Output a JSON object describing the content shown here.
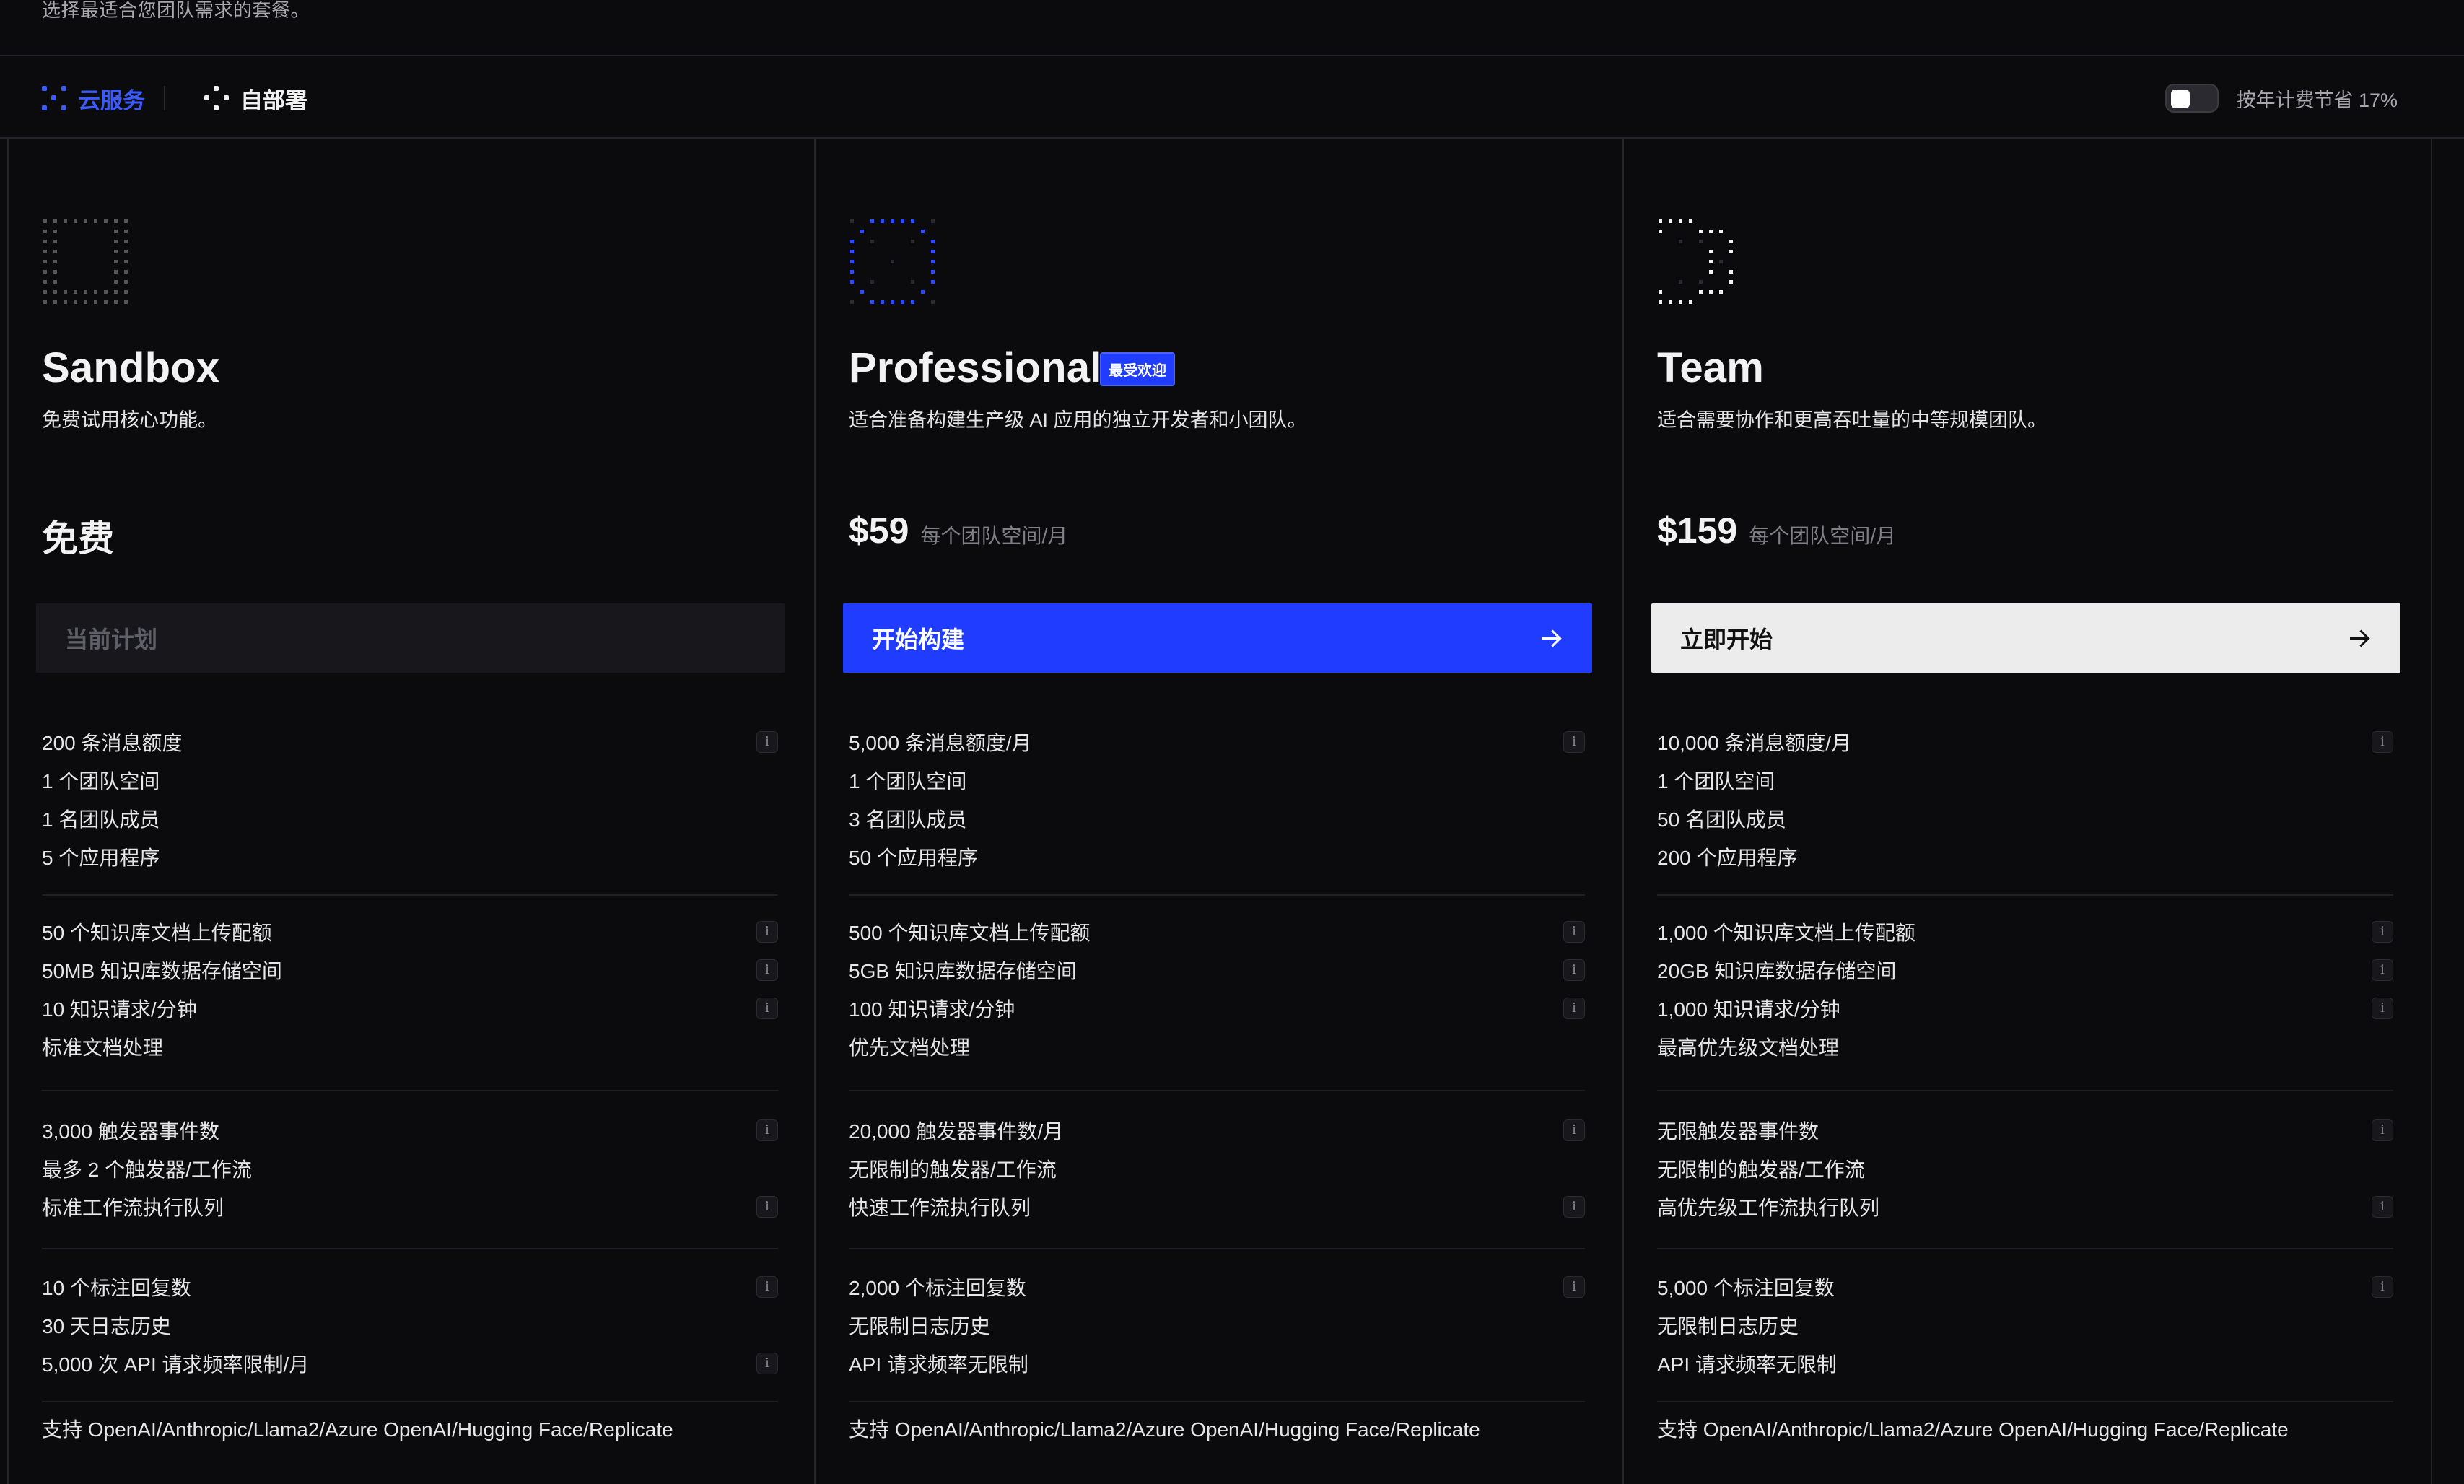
{
  "header": {
    "subtitle": "选择最适合您团队需求的套餐。",
    "tabs": [
      {
        "label": "云服务",
        "icon": "cloud-dots-icon",
        "active": true
      },
      {
        "label": "自部署",
        "icon": "self-host-dots-icon",
        "active": false
      }
    ],
    "billing_toggle_label": "按年计费节省 17%"
  },
  "plans": [
    {
      "name": "Sandbox",
      "badge": "",
      "description": "免费试用核心功能。",
      "price": "免费",
      "price_unit": "",
      "cta_label": "当前计划",
      "cta_style": "disabled",
      "groups": [
        [
          "200 条消息额度",
          "1 个团队空间",
          "1 名团队成员",
          "5 个应用程序"
        ],
        [
          "50 个知识库文档上传配额",
          "50MB 知识库数据存储空间",
          "10 知识请求/分钟",
          "标准文档处理"
        ],
        [
          "3,000 触发器事件数",
          "最多 2 个触发器/工作流",
          "标准工作流执行队列"
        ],
        [
          "10 个标注回复数",
          "30 天日志历史",
          "5,000 次 API 请求频率限制/月"
        ],
        [
          "支持 OpenAI/Anthropic/Llama2/Azure OpenAI/Hugging Face/Replicate"
        ]
      ]
    },
    {
      "name": "Professional",
      "badge": "最受欢迎",
      "description": "适合准备构建生产级 AI 应用的独立开发者和小团队。",
      "price": "$59",
      "price_unit": "每个团队空间/月",
      "cta_label": "开始构建",
      "cta_style": "primary",
      "groups": [
        [
          "5,000 条消息额度/月",
          "1 个团队空间",
          "3 名团队成员",
          "50 个应用程序"
        ],
        [
          "500 个知识库文档上传配额",
          "5GB 知识库数据存储空间",
          "100 知识请求/分钟",
          "优先文档处理"
        ],
        [
          "20,000 触发器事件数/月",
          "无限制的触发器/工作流",
          "快速工作流执行队列"
        ],
        [
          "2,000 个标注回复数",
          "无限制日志历史",
          "API 请求频率无限制"
        ],
        [
          "支持 OpenAI/Anthropic/Llama2/Azure OpenAI/Hugging Face/Replicate"
        ]
      ]
    },
    {
      "name": "Team",
      "badge": "",
      "description": "适合需要协作和更高吞吐量的中等规模团队。",
      "price": "$159",
      "price_unit": "每个团队空间/月",
      "cta_label": "立即开始",
      "cta_style": "secondary",
      "groups": [
        [
          "10,000 条消息额度/月",
          "1 个团队空间",
          "50 名团队成员",
          "200 个应用程序"
        ],
        [
          "1,000 个知识库文档上传配额",
          "20GB 知识库数据存储空间",
          "1,000 知识请求/分钟",
          "最高优先级文档处理"
        ],
        [
          "无限触发器事件数",
          "无限制的触发器/工作流",
          "高优先级工作流执行队列"
        ],
        [
          "5,000 个标注回复数",
          "无限制日志历史",
          "API 请求频率无限制"
        ],
        [
          "支持 OpenAI/Anthropic/Llama2/Azure OpenAI/Hugging Face/Replicate"
        ]
      ]
    }
  ],
  "info_icon_glyph": "i",
  "colors": {
    "accent": "#1f3cff",
    "background": "#0b0b0e"
  }
}
